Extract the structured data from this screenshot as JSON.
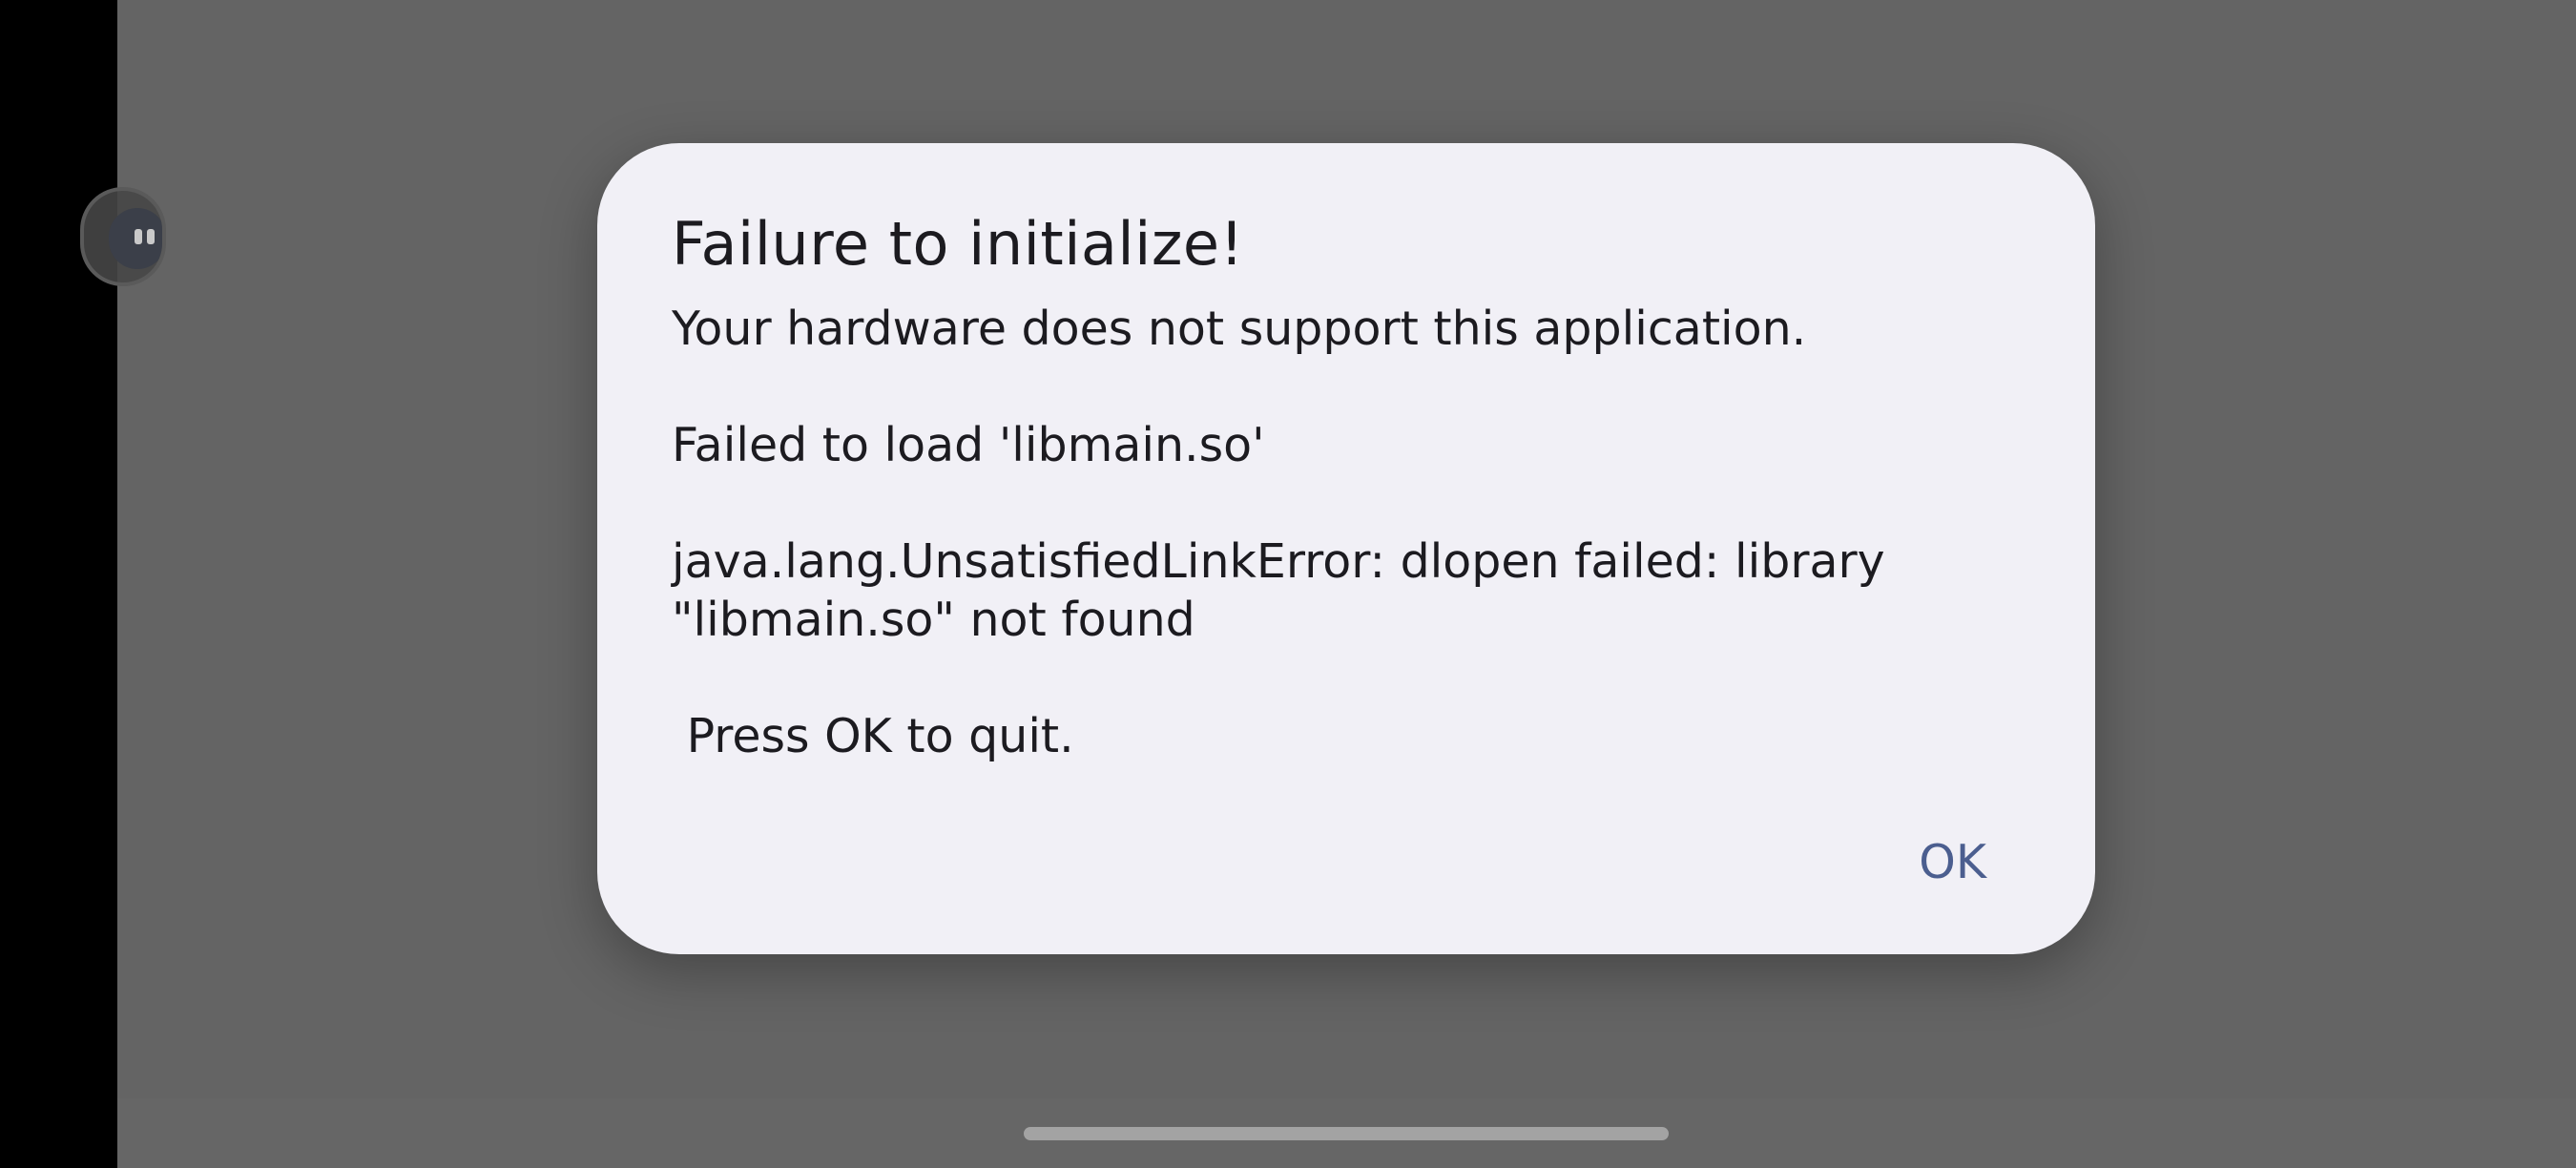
{
  "dialog": {
    "title": "Failure to initialize!",
    "message": "Your hardware does not support this application.\n\nFailed to load 'libmain.so'\n\njava.lang.UnsatisfiedLinkError: dlopen failed: library \"libmain.so\" not found\n\n Press OK to quit.",
    "ok_label": "OK"
  },
  "colors": {
    "scrim": "#646464",
    "dialog_background": "#f1f0f6",
    "text": "#1c1b20",
    "accent": "#4b5e8f"
  },
  "icons": {
    "floating_bubble": "floating-assistant-icon"
  }
}
